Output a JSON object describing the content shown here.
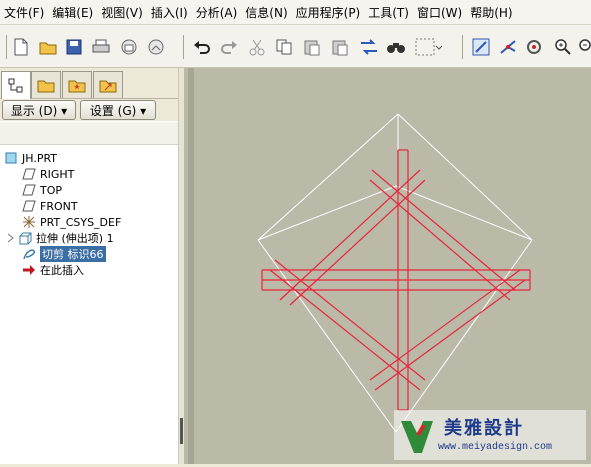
{
  "menu": [
    "文件(F)",
    "编辑(E)",
    "视图(V)",
    "插入(I)",
    "分析(A)",
    "信息(N)",
    "应用程序(P)",
    "工具(T)",
    "窗口(W)",
    "帮助(H)"
  ],
  "panel": {
    "show_label": "显示 (D) ▾",
    "settings_label": "设置 (G) ▾"
  },
  "tree": [
    {
      "label": "JH.PRT",
      "icon": "part-icon"
    },
    {
      "label": "RIGHT",
      "icon": "datum-plane-icon"
    },
    {
      "label": "TOP",
      "icon": "datum-plane-icon"
    },
    {
      "label": "FRONT",
      "icon": "datum-plane-icon"
    },
    {
      "label": "PRT_CSYS_DEF",
      "icon": "csys-icon"
    },
    {
      "label": "拉伸 (伸出项) 1",
      "icon": "extrude-icon"
    },
    {
      "label": "切剪 标识66",
      "icon": "cut-icon",
      "selected": true
    },
    {
      "label": "在此插入",
      "icon": "insert-here-arrow-icon"
    }
  ],
  "watermark": {
    "title": "美雅設計",
    "url": "www.meiyadesign.com"
  },
  "colors": {
    "model_lines": "#e8243c",
    "bounding_box": "#ffffff",
    "viewport_bg": "#bbbaa9"
  }
}
